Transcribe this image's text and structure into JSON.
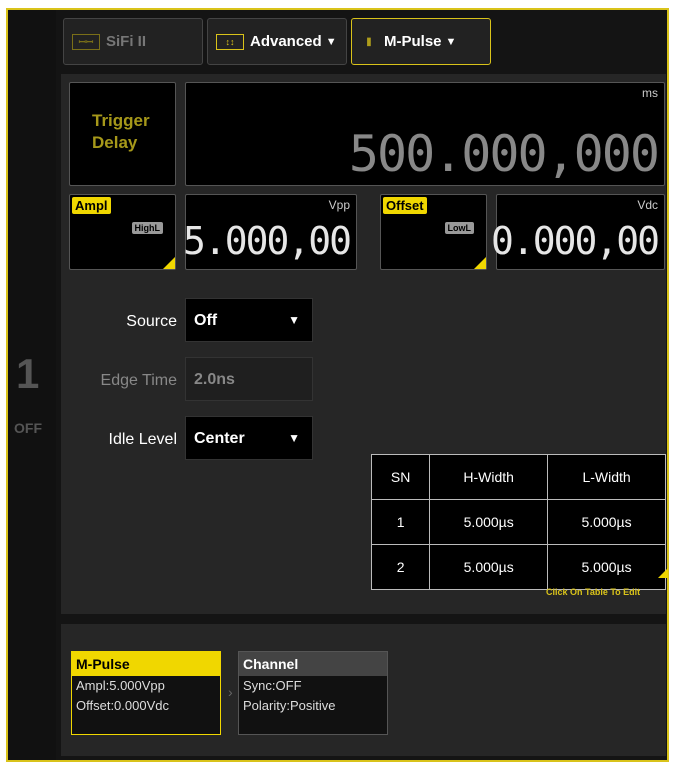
{
  "channel": {
    "number": "1",
    "state": "OFF"
  },
  "tabs": [
    {
      "label": "SiFi II",
      "icon": "sifi-icon",
      "caret": ""
    },
    {
      "label": "Advanced",
      "icon": "advanced-icon",
      "caret": "▼"
    },
    {
      "label": "M-Pulse",
      "icon": "m-pulse-icon",
      "caret": "▼"
    }
  ],
  "trigger_delay": {
    "label_line1": "Trigger",
    "label_line2": "Delay",
    "unit": "ms",
    "value": "500.000,000"
  },
  "ampl": {
    "badge": "Ampl",
    "sub": "HighL",
    "unit": "Vpp",
    "value": "5.000,00"
  },
  "offset": {
    "badge": "Offset",
    "sub": "LowL",
    "unit": "Vdc",
    "value": "0.000,00"
  },
  "settings": {
    "source": {
      "label": "Source",
      "value": "Off"
    },
    "edge_time": {
      "label": "Edge Time",
      "value": "2.0ns"
    },
    "idle_level": {
      "label": "Idle Level",
      "value": "Center"
    }
  },
  "table": {
    "headers": [
      "SN",
      "H-Width",
      "L-Width"
    ],
    "rows": [
      [
        "1",
        "5.000µs",
        "5.000µs"
      ],
      [
        "2",
        "5.000µs",
        "5.000µs"
      ]
    ],
    "hint": "Click On Table To Edit"
  },
  "summary": [
    {
      "title": "M-Pulse",
      "lines": [
        "Ampl:5.000Vpp",
        "Offset:0.000Vdc"
      ]
    },
    {
      "title": "Channel",
      "lines": [
        "Sync:OFF",
        "Polarity:Positive"
      ]
    }
  ],
  "colors": {
    "accent": "#f0d700",
    "frame": "#d9c31a",
    "background": "#141414"
  }
}
